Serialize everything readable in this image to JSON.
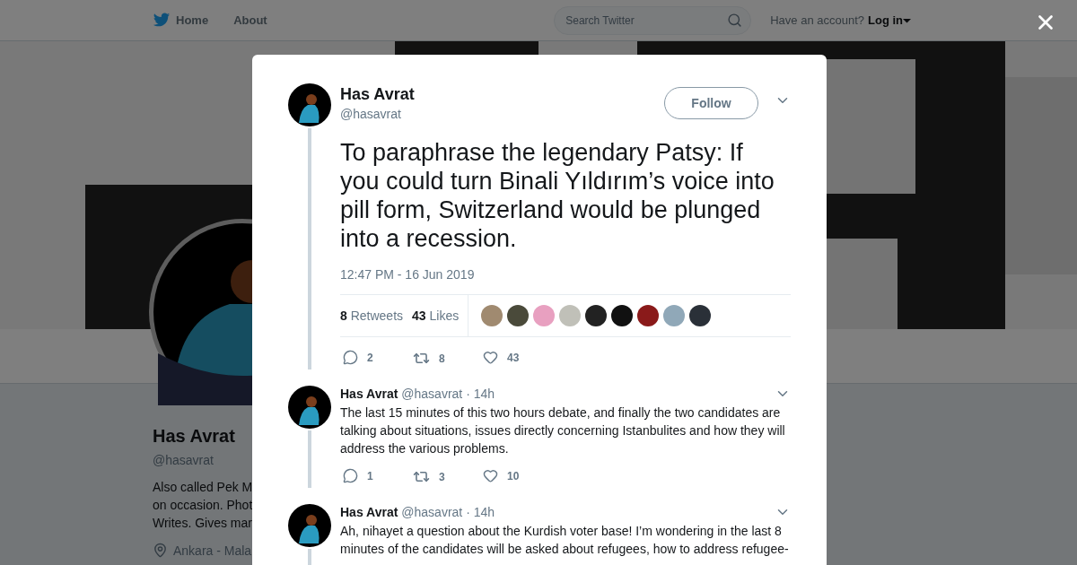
{
  "top_nav": {
    "links": [
      {
        "label": "Home",
        "kind": "home"
      },
      {
        "label": "About",
        "kind": "plain"
      }
    ],
    "search": {
      "placeholder": "Search Twitter"
    },
    "account_prompt": "Have an account?",
    "login": "Log in"
  },
  "profile": {
    "name": "Has Avrat",
    "handle": "@hasavrat",
    "bio_lines": [
      "Also called Pek M",
      "on occasion. Phot",
      "Writes. Gives mar"
    ],
    "location": "Ankara - Mala"
  },
  "tweet": {
    "name": "Has Avrat",
    "handle": "@hasavrat",
    "follow": "Follow",
    "text": "To paraphrase the legendary Patsy: If you could turn Binali Yıldırım’s voice into pill form, Switzerland would be plunged into a recession.",
    "time": "12:47 PM - 16 Jun 2019",
    "retweets": {
      "count": "8",
      "label": "Retweets"
    },
    "likes": {
      "count": "43",
      "label": "Likes"
    },
    "likers": [
      {
        "kind": "avatar"
      },
      {
        "kind": "avatar"
      },
      {
        "kind": "avatar"
      },
      {
        "kind": "avatar"
      },
      {
        "kind": "avatar"
      },
      {
        "kind": "avatar"
      },
      {
        "kind": "avatar"
      },
      {
        "kind": "avatar"
      },
      {
        "kind": "avatar"
      }
    ],
    "actions": [
      {
        "kind": "reply",
        "count": "2"
      },
      {
        "kind": "retweet",
        "count": "8"
      },
      {
        "kind": "like",
        "count": "43"
      }
    ]
  },
  "replies": [
    {
      "name": "Has Avrat",
      "handle": "@hasavrat",
      "time": "· 14h",
      "text": "The last 15 minutes of this two hours debate, and finally the two candidates are talking about situations, issues directly concerning Istanbulites and how they will address the various problems.",
      "actions": [
        {
          "kind": "reply",
          "count": "1"
        },
        {
          "kind": "retweet",
          "count": "3"
        },
        {
          "kind": "like",
          "count": "10"
        }
      ]
    },
    {
      "name": "Has Avrat",
      "handle": "@hasavrat",
      "time": "· 14h",
      "text": "Ah, nihayet a question about the Kurdish voter base! I’m wondering in the last 8 minutes of the candidates will be asked about refugees, how to address refugee-"
    }
  ]
}
